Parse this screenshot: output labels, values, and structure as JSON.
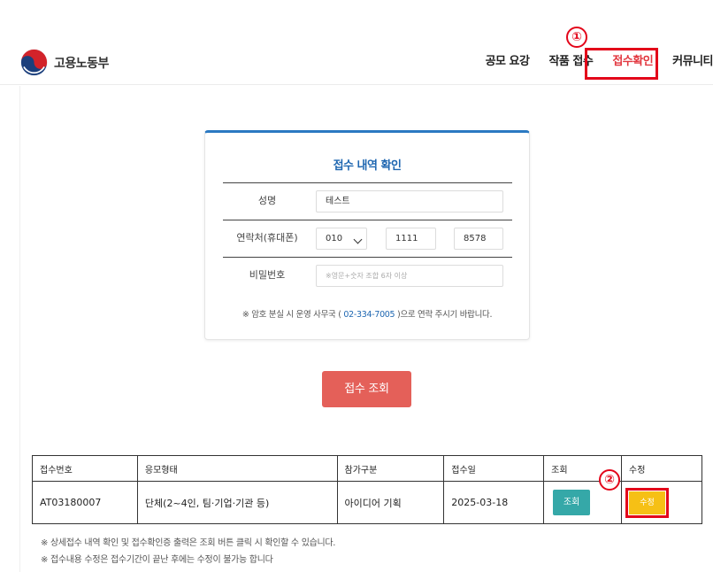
{
  "header": {
    "logo_text": "고용노동부",
    "nav": [
      {
        "label": "공모 요강",
        "active": false
      },
      {
        "label": "작품 접수",
        "active": false
      },
      {
        "label": "접수확인",
        "active": true
      },
      {
        "label": "커뮤니티",
        "active": false
      }
    ]
  },
  "markers": {
    "one": "①",
    "two": "②"
  },
  "card": {
    "title": "접수 내역 확인",
    "name_label": "성명",
    "name_value": "테스트",
    "phone_label": "연락처(휴대폰)",
    "phone_prefix": "010",
    "phone_mid": "1111",
    "phone_last": "8578",
    "password_label": "비밀번호",
    "password_placeholder": "※영문+숫자 조합 6자 이상",
    "notice_before": "※ 암호 분실 시 운영 사무국 (",
    "notice_phone": "02-334-7005",
    "notice_after": ")으로 연락 주시기 바랍니다."
  },
  "search_button": "접수 조회",
  "table": {
    "headers": [
      "접수번호",
      "응모형태",
      "참가구분",
      "접수일",
      "조회",
      "수정"
    ],
    "row": {
      "number": "AT03180007",
      "type": "단체(2~4인, 팀·기업·기관 등)",
      "category": "아이디어 기획",
      "date": "2025-03-18",
      "view_label": "조회",
      "edit_label": "수정"
    }
  },
  "footnotes": [
    "※ 상세접수 내역 확인 및 접수확인증 출력은 조회 버튼 클릭 시 확인할 수 있습니다.",
    "※ 접수내용 수정은 접수기간이 끝난 후에는 수정이 불가능 합니다"
  ],
  "colors": {
    "brand_blue": "#1f67b1",
    "active_red": "#e2373f",
    "search_button": "#e46059",
    "view_button": "#35a8a8",
    "edit_button": "#f6c015",
    "highlight": "#e3051a"
  }
}
